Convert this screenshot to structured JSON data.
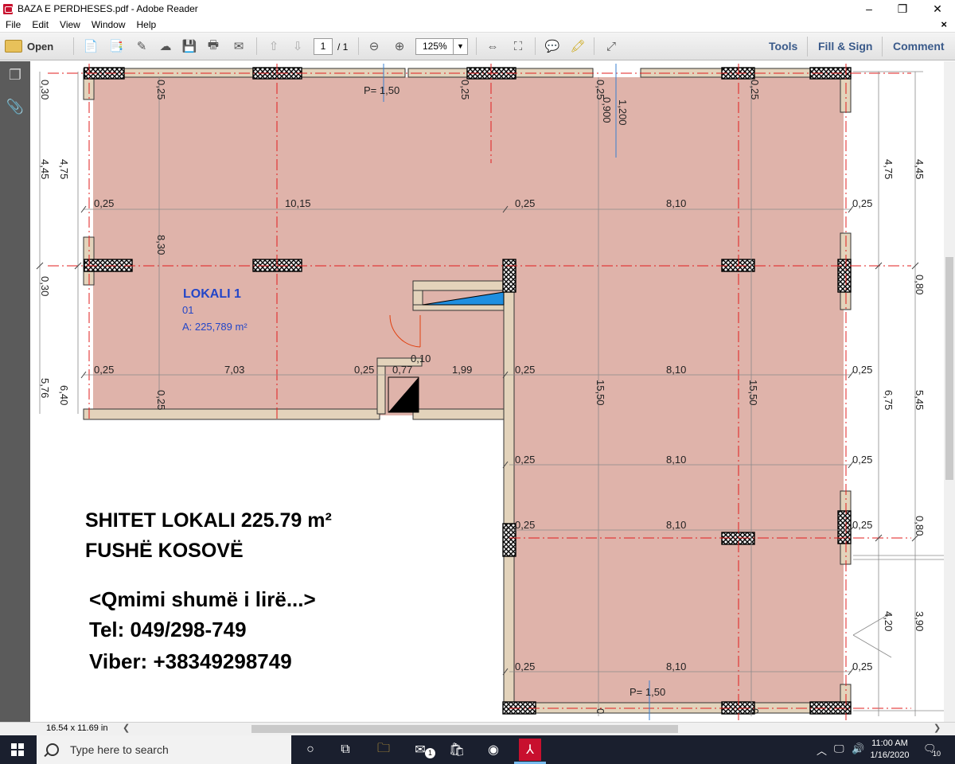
{
  "window": {
    "title": "BAZA E PERDHESES.pdf - Adobe Reader",
    "minimize": "–",
    "restore": "❐",
    "close": "✕"
  },
  "menu": {
    "items": [
      "File",
      "Edit",
      "View",
      "Window",
      "Help"
    ],
    "close_doc": "×"
  },
  "toolbar": {
    "open_label": "Open",
    "page_current": "1",
    "page_total": "/ 1",
    "zoom": "125%",
    "tools_label": "Tools",
    "fill_sign_label": "Fill & Sign",
    "comment_label": "Comment"
  },
  "status": {
    "page_size": "16.54 x 11.69 in"
  },
  "plan": {
    "colors": {
      "room_fill": "#dfb3aa",
      "wall_fill": "#e3d3bb",
      "axis_red": "#e01e1e",
      "dim_grey": "#777777",
      "label_blue": "#2346c8"
    },
    "room": {
      "name": "LOKALI 1",
      "number": "01",
      "area": "A: 225,789 m²"
    },
    "parapet_top": "P= 1,50",
    "parapet_bottom": "P= 1,50",
    "dims": {
      "d0_25": "0,25",
      "d0_30": "0,30",
      "d4_45": "4,45",
      "d4_75": "4,75",
      "d5_76": "5,76",
      "d6_40": "6,40",
      "d8_30": "8,30",
      "d10_15": "10,15",
      "d8_10": "8,10",
      "d7_03": "7,03",
      "d0_77": "0,77",
      "d1_99": "1,99",
      "d0_10": "0,10",
      "d15_50": "15,50",
      "d0_900": "0,900",
      "d1_200": "1,200",
      "d0_80": "0,80",
      "d5_45": "5,45",
      "d6_75": "6,75",
      "d4_20": "4,20",
      "d3_90": "3,90",
      "d0_25_mirror": "0,25",
      "d0_sub": "0"
    },
    "ad": {
      "line1": "SHITET LOKALI 225.79 m²",
      "line2": "FUSHË KOSOVË",
      "line3": "<Qmimi shumë i lirë...>",
      "line4": "Tel: 049/298-749",
      "line5": "Viber: +38349298749"
    }
  },
  "taskbar": {
    "search_placeholder": "Type here to search",
    "time": "11:00 AM",
    "date": "1/16/2020",
    "notif_count": "10",
    "mail_badge": "1"
  }
}
